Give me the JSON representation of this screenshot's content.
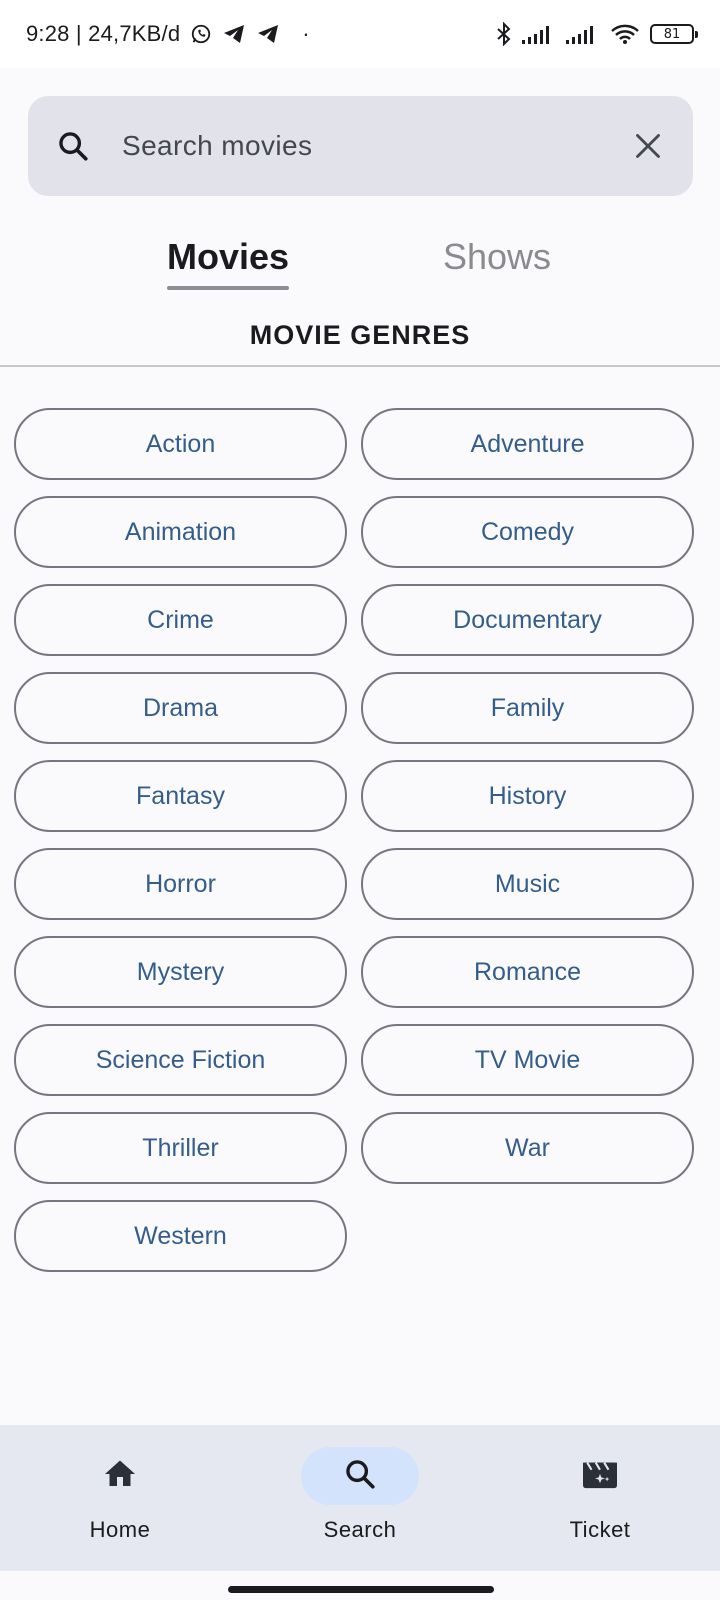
{
  "status_bar": {
    "time_info": "9:28 | 24,7KB/d",
    "dot": "·",
    "battery": "81"
  },
  "search": {
    "placeholder": "Search movies"
  },
  "tabs": [
    {
      "label": "Movies",
      "active": true
    },
    {
      "label": "Shows",
      "active": false
    }
  ],
  "section_title": "MOVIE GENRES",
  "genres": [
    "Action",
    "Adventure",
    "Animation",
    "Comedy",
    "Crime",
    "Documentary",
    "Drama",
    "Family",
    "Fantasy",
    "History",
    "Horror",
    "Music",
    "Mystery",
    "Romance",
    "Science Fiction",
    "TV Movie",
    "Thriller",
    "War",
    "Western"
  ],
  "bottom_nav": [
    {
      "label": "Home",
      "icon": "home-icon",
      "active": false
    },
    {
      "label": "Search",
      "icon": "search-icon",
      "active": true
    },
    {
      "label": "Ticket",
      "icon": "ticket-icon",
      "active": false
    }
  ],
  "colors": {
    "accent": "#355d8a",
    "search_bg": "#e2e3ea",
    "nav_bg": "#e6e8f1",
    "nav_active_pill": "#d3e3fb"
  }
}
